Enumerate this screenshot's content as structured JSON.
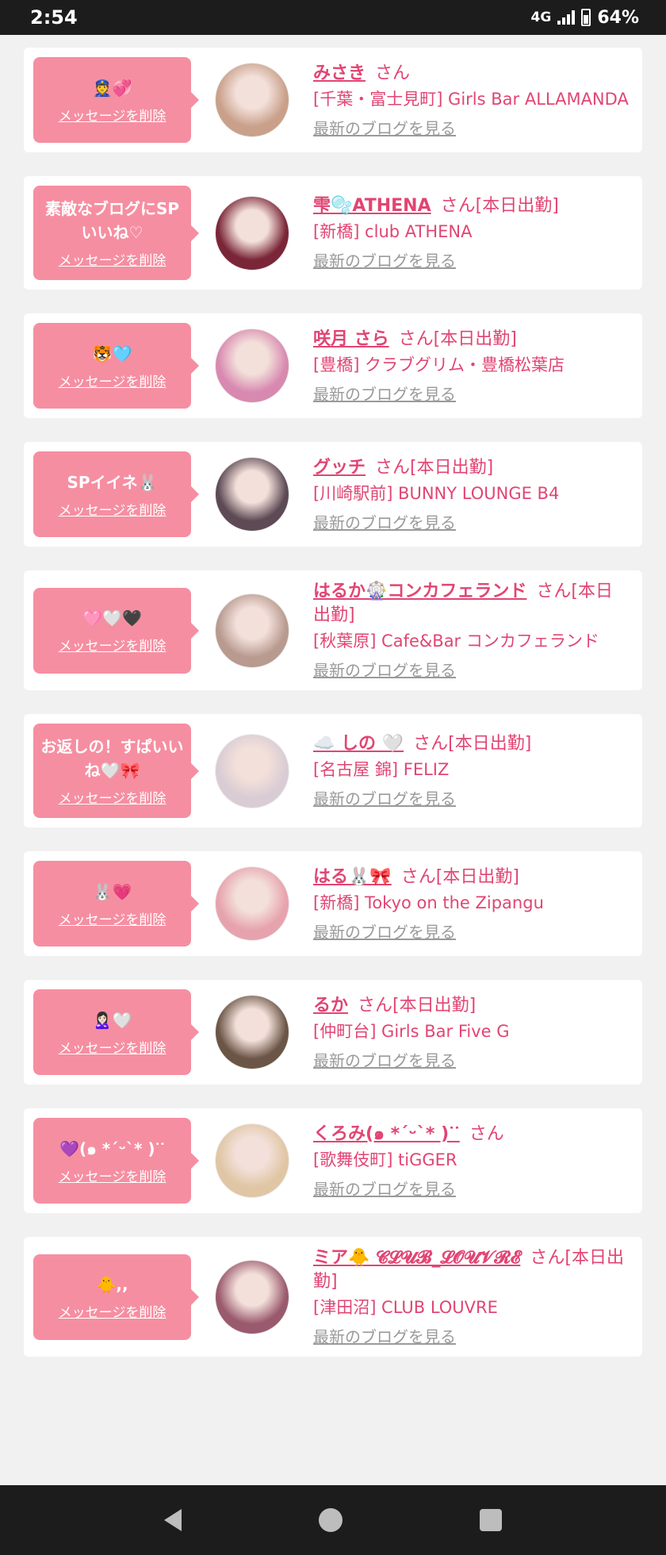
{
  "status": {
    "time": "2:54",
    "network": "4G",
    "battery": "64%"
  },
  "common": {
    "delete_label": "メッセージを削除",
    "blog_label": "最新のブログを見る"
  },
  "colors": {
    "bubble": "#f68ea1",
    "accent": "#e14573",
    "link_gray": "#9a9a9a"
  },
  "items": [
    {
      "message": "👮💞",
      "name": "みさき",
      "suffix": "さん",
      "shop": "[千葉・富士見町] Girls Bar ALLAMANDA",
      "avatar_color": "#c9a08a"
    },
    {
      "message": "素敵なブログにSPいいね♡",
      "name": "雫🫧ATHENA",
      "suffix": "さん[本日出勤]",
      "shop": "[新橋] club ATHENA",
      "avatar_color": "#7a2638"
    },
    {
      "message": "🐯🩵",
      "name": "咲月 さら",
      "suffix": "さん[本日出勤]",
      "shop": "[豊橋] クラブグリム・豊橋松葉店",
      "avatar_color": "#d889b0"
    },
    {
      "message": "SPイイネ🐰",
      "name": "グッチ",
      "suffix": "さん[本日出勤]",
      "shop": "[川崎駅前] BUNNY LOUNGE B4",
      "avatar_color": "#5d4a55"
    },
    {
      "message": "🩷🤍🖤",
      "name": "はるか🎡コンカフェランド",
      "suffix": "さん[本日出勤]",
      "shop": "[秋葉原] Cafe&Bar コンカフェランド",
      "avatar_color": "#b89a8f"
    },
    {
      "message": "お返しの！すぱいいね🤍🎀",
      "name": "☁️ しの 🤍",
      "suffix": "さん[本日出勤]",
      "shop": "[名古屋 錦] FELIZ",
      "avatar_color": "#d9ccd4"
    },
    {
      "message": "🐰💗",
      "name": "はる🐰🎀",
      "suffix": "さん[本日出勤]",
      "shop": "[新橋] Tokyo on the Zipangu",
      "avatar_color": "#e7a3ad"
    },
    {
      "message": "🙎🏻‍♀️🤍",
      "name": "るか",
      "suffix": "さん[本日出勤]",
      "shop": "[仲町台] Girls Bar Five G",
      "avatar_color": "#6b5546"
    },
    {
      "message": "💜(๑ *ˊᵕˋ* )ᐝᐝ",
      "name": "くろみ(๑ *ˊᵕˋ* )ᐝᐝ",
      "suffix": "さん",
      "shop": "[歌舞伎町] tiGGER",
      "avatar_color": "#e0c6a4"
    },
    {
      "message": "🐥,,",
      "name": "ミア🐥 𝓒𝓛𝓤𝓑_𝓛𝓞𝓤𝓥𝓡𝓔",
      "suffix": "さん[本日出勤]",
      "shop": "[津田沼] CLUB LOUVRE",
      "avatar_color": "#9a5a6e"
    }
  ]
}
